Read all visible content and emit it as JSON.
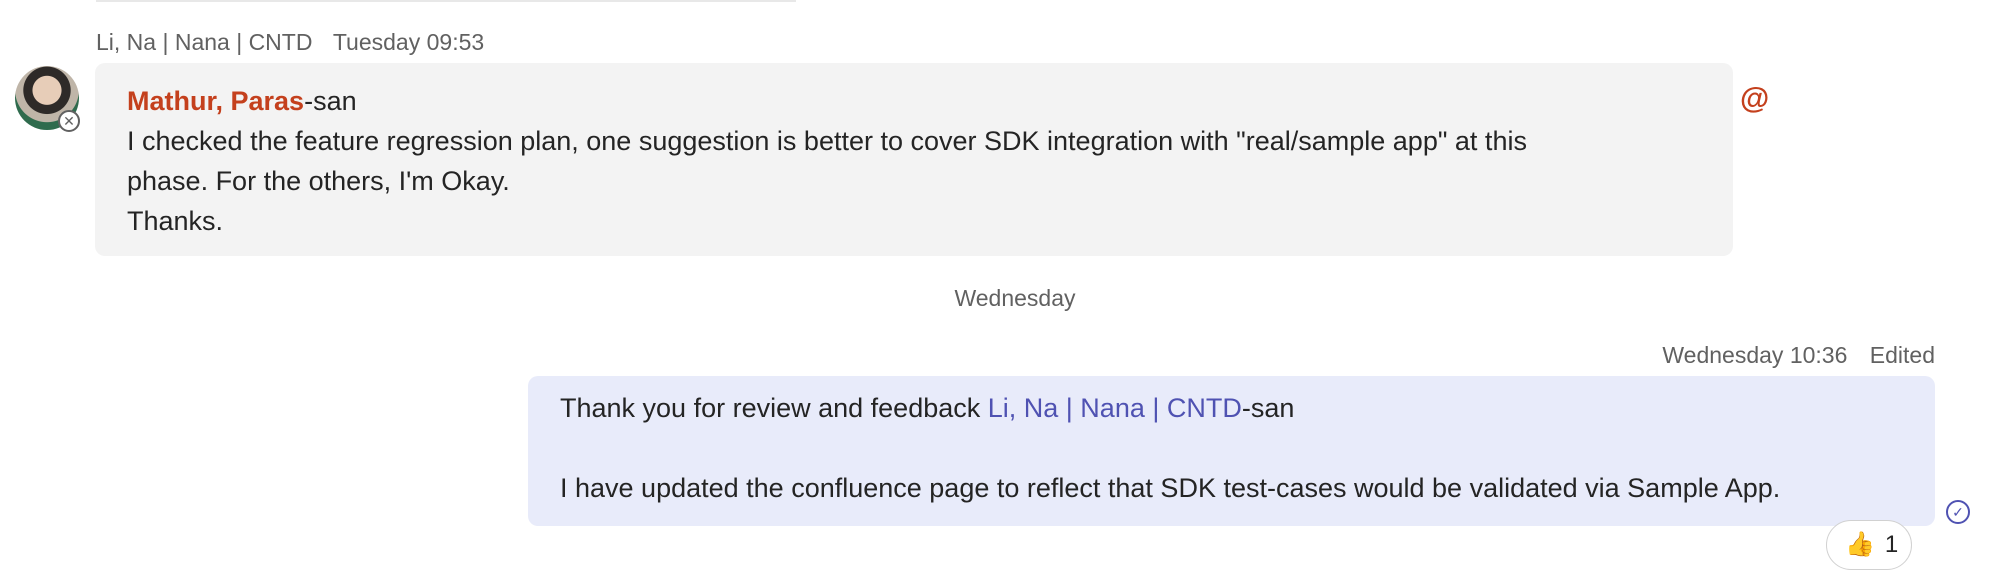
{
  "incoming": {
    "sender": "Li, Na | Nana | CNTD",
    "time": "Tuesday 09:53",
    "mention": "Mathur, Paras",
    "mention_suffix": "-san",
    "line1": "I checked the feature regression plan, one suggestion is better to cover SDK integration with \"real/sample app\" at this",
    "line2": "phase. For the others, I'm Okay.",
    "line3": "Thanks.",
    "mention_icon": "@"
  },
  "day_separator": "Wednesday",
  "outgoing": {
    "time": "Wednesday 10:36",
    "edited": "Edited",
    "line1_prefix": "Thank you for review and feedback ",
    "mention": "Li, Na | Nana | CNTD",
    "mention_suffix": "-san",
    "line2": "I have updated the confluence page to reflect that SDK test-cases would be validated via Sample App."
  },
  "reaction": {
    "emoji": "👍",
    "count": "1"
  },
  "icons": {
    "avatar_status": "blocked-status-icon",
    "read_receipt": "seen-check-icon",
    "mention": "at-mention-icon",
    "reaction": "thumbs-up-icon"
  },
  "colors": {
    "mention_self": "#c4401d",
    "mention_other": "#4f52b2",
    "incoming_bubble": "#f3f3f3",
    "outgoing_bubble": "#e8ebfa"
  }
}
